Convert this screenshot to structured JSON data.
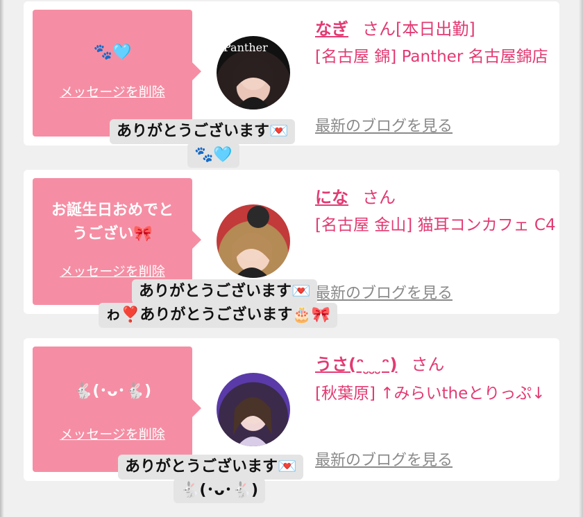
{
  "cards": [
    {
      "message": "🐾🩵",
      "delete_label": "メッセージを削除",
      "cast_name": "なぎ",
      "honorific": "さん[本日出勤]",
      "shop": "[名古屋 錦] Panther 名古屋錦店",
      "blog_link": "最新のブログを見る",
      "reply_line1": "ありがとうございます💌",
      "reply_line2": "🐾🩵",
      "avatar_text": "Panther"
    },
    {
      "message_line1": "お誕生日おめでと",
      "message_line2": "うござい🎀",
      "delete_label": "メッセージを削除",
      "cast_name": "にな",
      "honorific": "さん",
      "shop": "[名古屋 金山] 猫耳コンカフェ C4",
      "blog_link": "最新のブログを見る",
      "reply_line1": "ありがとうございます💌",
      "reply_line2": "ゎ❣️ありがとうございます🎂🎀"
    },
    {
      "message": "🐇(･ᴗ･🐇)",
      "delete_label": "メッセージを削除",
      "cast_name": "うさ(ᵔ ̮ ̮ ̮ᵔ)",
      "honorific": "さん",
      "shop": "[秋葉原] ↑みらいtheとりっぷ↓",
      "blog_link": "最新のブログを見る",
      "reply_line1": "ありがとうございます💌",
      "reply_line2": "🐇(･ᴗ･🐇)"
    }
  ],
  "colors": {
    "accent_pink": "#e23a72",
    "message_box": "#f58ea4",
    "reply_bubble": "#e4e4e4"
  }
}
